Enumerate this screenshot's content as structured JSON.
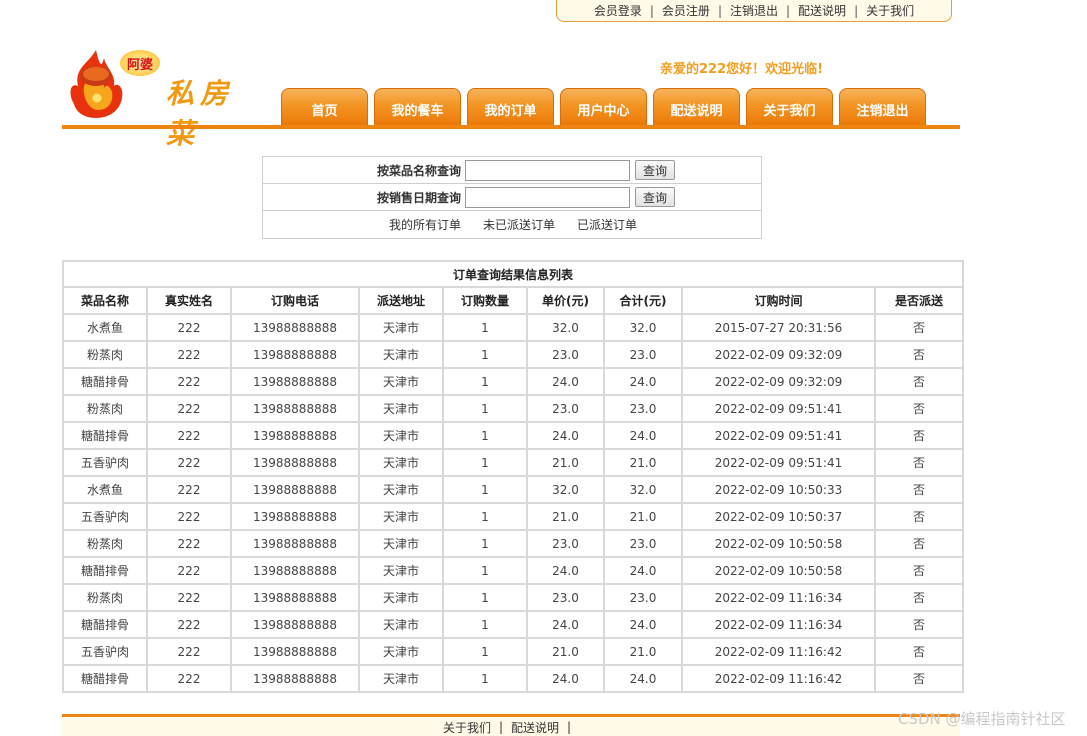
{
  "top_links": [
    "会员登录",
    "会员注册",
    "注销退出",
    "配送说明",
    "关于我们"
  ],
  "logo": {
    "badge_text": "阿婆",
    "brand_text": "私房菜"
  },
  "welcome": "亲爱的222您好！欢迎光临!",
  "nav": [
    "首页",
    "我的餐车",
    "我的订单",
    "用户中心",
    "配送说明",
    "关于我们",
    "注销退出"
  ],
  "search": {
    "name_label": "按菜品名称查询",
    "name_value": "",
    "date_label": "按销售日期查询",
    "date_value": "",
    "query_button": "查询",
    "links": [
      "我的所有订单",
      "未已派送订单",
      "已派送订单"
    ]
  },
  "results": {
    "caption": "订单查询结果信息列表",
    "columns": [
      "菜品名称",
      "真实姓名",
      "订购电话",
      "派送地址",
      "订购数量",
      "单价(元)",
      "合计(元)",
      "订购时间",
      "是否派送"
    ],
    "rows": [
      [
        "水煮鱼",
        "222",
        "13988888888",
        "天津市",
        "1",
        "32.0",
        "32.0",
        "2015-07-27 20:31:56",
        "否"
      ],
      [
        "粉蒸肉",
        "222",
        "13988888888",
        "天津市",
        "1",
        "23.0",
        "23.0",
        "2022-02-09 09:32:09",
        "否"
      ],
      [
        "糖醋排骨",
        "222",
        "13988888888",
        "天津市",
        "1",
        "24.0",
        "24.0",
        "2022-02-09 09:32:09",
        "否"
      ],
      [
        "粉蒸肉",
        "222",
        "13988888888",
        "天津市",
        "1",
        "23.0",
        "23.0",
        "2022-02-09 09:51:41",
        "否"
      ],
      [
        "糖醋排骨",
        "222",
        "13988888888",
        "天津市",
        "1",
        "24.0",
        "24.0",
        "2022-02-09 09:51:41",
        "否"
      ],
      [
        "五香驴肉",
        "222",
        "13988888888",
        "天津市",
        "1",
        "21.0",
        "21.0",
        "2022-02-09 09:51:41",
        "否"
      ],
      [
        "水煮鱼",
        "222",
        "13988888888",
        "天津市",
        "1",
        "32.0",
        "32.0",
        "2022-02-09 10:50:33",
        "否"
      ],
      [
        "五香驴肉",
        "222",
        "13988888888",
        "天津市",
        "1",
        "21.0",
        "21.0",
        "2022-02-09 10:50:37",
        "否"
      ],
      [
        "粉蒸肉",
        "222",
        "13988888888",
        "天津市",
        "1",
        "23.0",
        "23.0",
        "2022-02-09 10:50:58",
        "否"
      ],
      [
        "糖醋排骨",
        "222",
        "13988888888",
        "天津市",
        "1",
        "24.0",
        "24.0",
        "2022-02-09 10:50:58",
        "否"
      ],
      [
        "粉蒸肉",
        "222",
        "13988888888",
        "天津市",
        "1",
        "23.0",
        "23.0",
        "2022-02-09 11:16:34",
        "否"
      ],
      [
        "糖醋排骨",
        "222",
        "13988888888",
        "天津市",
        "1",
        "24.0",
        "24.0",
        "2022-02-09 11:16:34",
        "否"
      ],
      [
        "五香驴肉",
        "222",
        "13988888888",
        "天津市",
        "1",
        "21.0",
        "21.0",
        "2022-02-09 11:16:42",
        "否"
      ],
      [
        "糖醋排骨",
        "222",
        "13988888888",
        "天津市",
        "1",
        "24.0",
        "24.0",
        "2022-02-09 11:16:42",
        "否"
      ]
    ]
  },
  "footer_links": [
    "关于我们",
    "配送说明"
  ],
  "watermark": "CSDN @编程指南针社区",
  "colors": {
    "accent": "#f08410",
    "welcome": "#f0a020",
    "tab": "#f39423"
  },
  "icons": {
    "logo": "flame-logo-icon"
  }
}
